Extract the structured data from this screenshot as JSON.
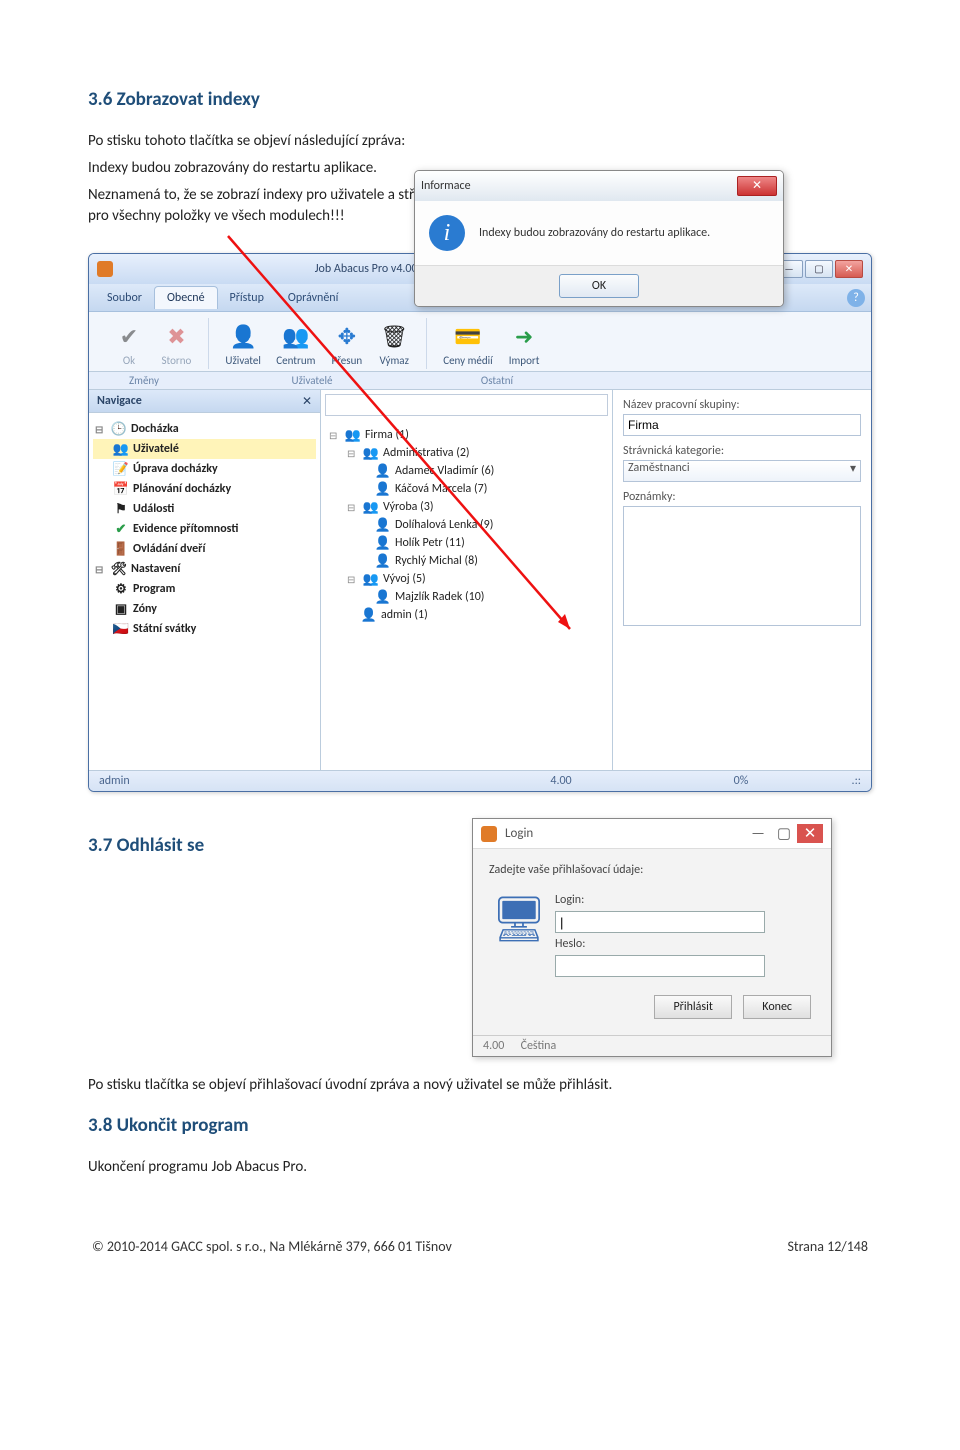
{
  "doc": {
    "sec36_title": "3.6 Zobrazovat indexy",
    "sec36_p1": "Po stisku tohoto tlačítka se objeví následující zpráva:",
    "sec36_p2": "Indexy budou zobrazovány do restartu aplikace.",
    "sec36_p3": "Neznamená to, že se zobrazí indexy pro uživatele a střediska, ale pro všechny položky ve všech modulech!!!",
    "sec37_title": "3.7 Odhlásit se",
    "sec37_p1": "Po stisku tlačítka se objeví přihlašovací úvodní zpráva a nový uživatel se může přihlásit.",
    "sec38_title": "3.8 Ukončit program",
    "sec38_p1": "Ukončení programu Job Abacus Pro.",
    "footer_left": "© 2010-2014 GACC spol. s r.o., Na Mlékárně 379, 666 01 Tišnov",
    "footer_right": "Strana 12/148"
  },
  "info_dialog": {
    "title": "Informace",
    "message": "Indexy budou zobrazovány do restartu aplikace.",
    "ok": "OK"
  },
  "app": {
    "title": "Job Abacus Pro v4.00 (C) GACC spol. s r.o., 2009-2013",
    "tabs": {
      "soubor": "Soubor",
      "obecne": "Obecné",
      "pristup": "Přístup",
      "opravneni": "Oprávnění"
    },
    "tools": {
      "ok": "Ok",
      "storno": "Storno",
      "uzivatel": "Uživatel",
      "centrum": "Centrum",
      "presun": "Přesun",
      "vymaz": "Výmaz",
      "ceny": "Ceny médií",
      "import": "Import"
    },
    "groups": {
      "zmeny": "Změny",
      "uzivatele": "Uživatelé",
      "ostatni": "Ostatní"
    },
    "nav": {
      "title": "Navigace",
      "items": {
        "dochazka": "Docházka",
        "uzivatele": "Uživatelé",
        "uprava": "Úprava docházky",
        "planovani": "Plánování docházky",
        "udalosti": "Události",
        "evidence": "Evidence přítomnosti",
        "ovladani": "Ovládání dveří",
        "nastaveni": "Nastavení",
        "program": "Program",
        "zony": "Zóny",
        "svatky": "Státní svátky"
      }
    },
    "tree": {
      "firma": "Firma (1)",
      "admin_grp": "Administrativa (2)",
      "adamec": "Adamec Vladimír (6)",
      "kacova": "Káčová Marcela (7)",
      "vyroba": "Výroba (3)",
      "dolihal": "Dolíhalová Lenka (9)",
      "holik": "Holík Petr (11)",
      "rychly": "Rychlý Michal (8)",
      "vyvoj": "Vývoj (5)",
      "majzlik": "Majzlík Radek (10)",
      "admin": "admin (1)"
    },
    "right": {
      "grp_lbl": "Název pracovní skupiny:",
      "grp_val": "Firma",
      "cat_lbl": "Strávnická kategorie:",
      "cat_val": "Zaměstnanci",
      "notes_lbl": "Poznámky:"
    },
    "status": {
      "user": "admin",
      "ver": "4.00",
      "pct": "0%",
      "grip": ".::"
    }
  },
  "login": {
    "title": "Login",
    "prompt": "Zadejte vaše přihlašovací údaje:",
    "login_lbl": "Login:",
    "heslo_lbl": "Heslo:",
    "btn_ok": "Přihlásit",
    "btn_cancel": "Konec",
    "ver": "4.00",
    "lang": "Čeština"
  }
}
